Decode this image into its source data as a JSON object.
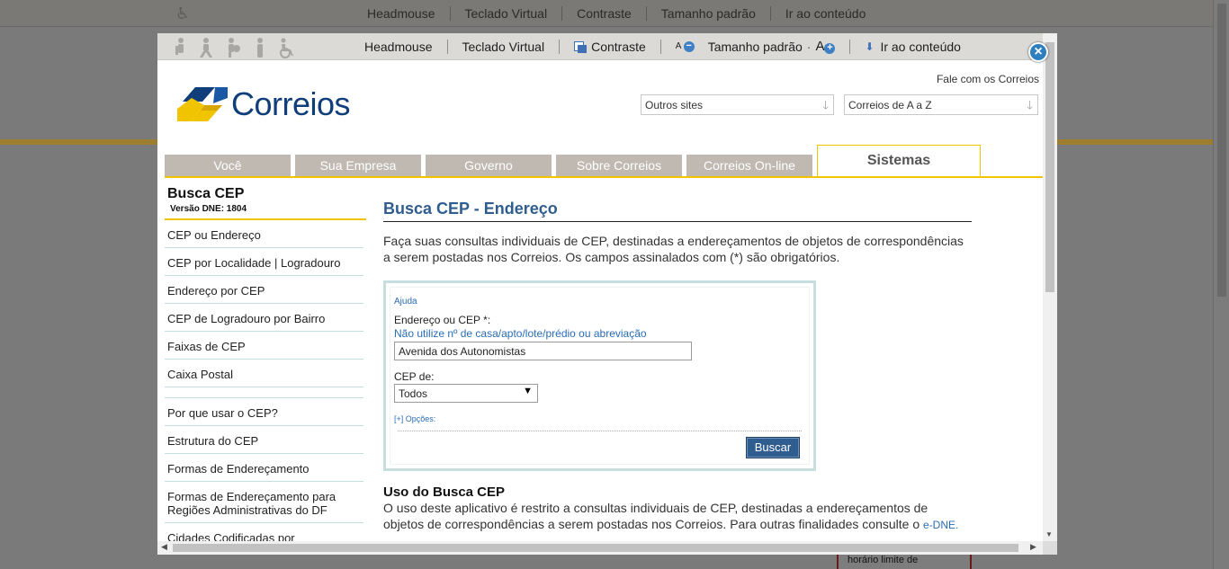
{
  "accessibility": {
    "headmouse": "Headmouse",
    "teclado": "Teclado Virtual",
    "contraste": "Contraste",
    "font_small": "A",
    "tamanho": "Tamanho padrão",
    "font_large": "A",
    "ir_conteudo": "Ir ao conteúdo"
  },
  "header": {
    "logo_text": "Correios",
    "fale": "Fale com os Correios",
    "outros_sites": "Outros sites",
    "correios_az": "Correios de A a Z"
  },
  "tabs": [
    "Você",
    "Sua Empresa",
    "Governo",
    "Sobre Correios",
    "Correios On-line",
    "Sistemas"
  ],
  "sidebar": {
    "title": "Busca CEP",
    "version": "Versão DNE: 1804",
    "items_top": [
      "CEP ou Endereço",
      "CEP por Localidade | Logradouro",
      "Endereço por CEP",
      "CEP de Logradouro por Bairro",
      "Faixas de CEP",
      "Caixa Postal"
    ],
    "items_bottom": [
      "Por que usar o CEP?",
      "Estrutura do CEP",
      "Formas de Endereçamento",
      "Formas de Endereçamento para Regiões Administrativas do DF",
      "Cidades Codificadas por"
    ]
  },
  "main": {
    "title": "Busca CEP - Endereço",
    "intro": "Faça suas consultas individuais de CEP, destinadas a endereçamentos de objetos de correspondências a serem postadas nos Correios. Os campos assinalados com (*) são obrigatórios."
  },
  "form": {
    "ajuda": "Ajuda",
    "endereco_label": "Endereço ou CEP *:",
    "endereco_hint": "Não utilize nº de casa/apto/lote/prédio ou abreviação",
    "endereco_value": "Avenida dos Autonomistas",
    "cep_de_label": "CEP de:",
    "cep_de_value": "Todos",
    "opcoes": "[+] Opções:",
    "buscar": "Buscar"
  },
  "uso": {
    "title": "Uso do Busca CEP",
    "text": "O uso deste aplicativo é restrito a consultas individuais de CEP, destinadas a endereçamentos de objetos de correspondências a serem postadas nos Correios. Para outras finalidades consulte o",
    "link": "e-DNE."
  },
  "background": {
    "card_text": "horário limite de"
  },
  "colors": {
    "brand_blue": "#0f3e7a",
    "accent_yellow": "#f1c400",
    "title_blue": "#2f5d8f",
    "tab_gray": "#c0b9b1"
  }
}
